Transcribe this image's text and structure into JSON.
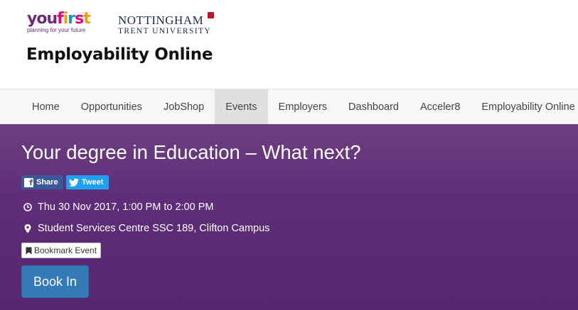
{
  "branding": {
    "youfirst_logo": "youfirst",
    "youfirst_tagline": "planning for your future",
    "university_line1": "NOTTINGHAM",
    "university_line2": "TRENT UNIVERSITY",
    "site_title": "Employability Online"
  },
  "nav": {
    "items": [
      {
        "label": "Home"
      },
      {
        "label": "Opportunities"
      },
      {
        "label": "JobShop"
      },
      {
        "label": "Events",
        "active": true
      },
      {
        "label": "Employers"
      },
      {
        "label": "Dashboard"
      },
      {
        "label": "Acceler8"
      },
      {
        "label": "Employability Online"
      }
    ]
  },
  "event": {
    "title": "Your degree in Education – What next?",
    "share_label": "Share",
    "tweet_label": "Tweet",
    "datetime": "Thu 30 Nov 2017, 1:00 PM to 2:00 PM",
    "location": "Student Services Centre SSC 189, Clifton Campus",
    "bookmark_label": "Bookmark Event",
    "book_in_label": "Book In"
  },
  "colors": {
    "hero_purple": "#5f2d79",
    "primary_button": "#337ab7",
    "facebook": "#3b5998",
    "twitter": "#1da1f2",
    "nav_active": "#e0e0e0"
  },
  "icons": {
    "facebook": "facebook-icon",
    "twitter": "twitter-icon",
    "clock": "clock-icon",
    "location": "map-marker-icon",
    "bookmark": "bookmark-icon"
  }
}
